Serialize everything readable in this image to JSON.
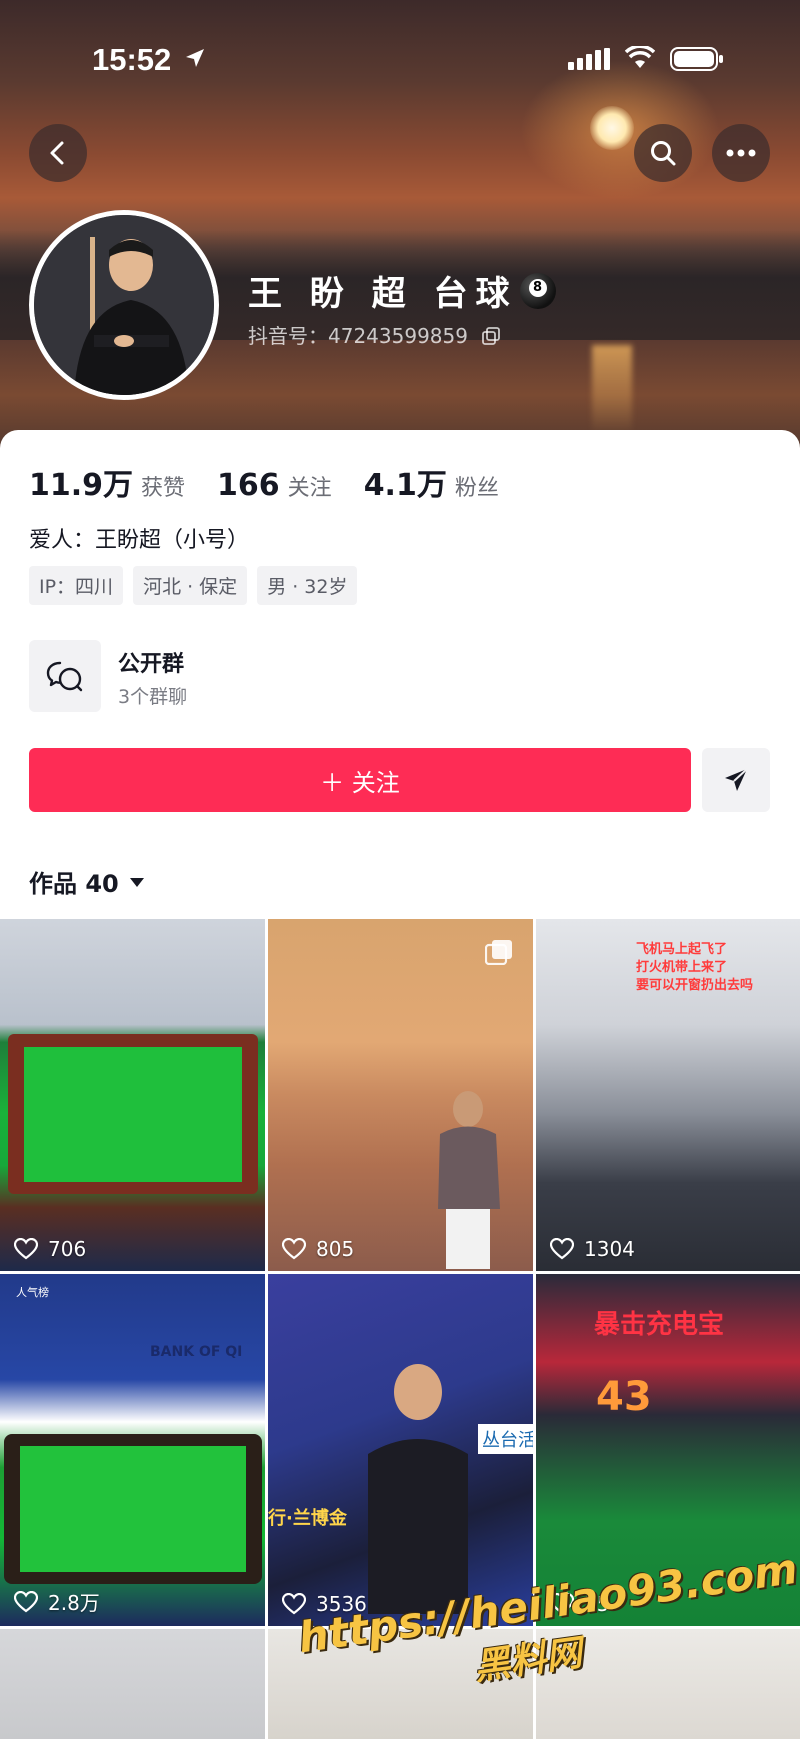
{
  "status_bar": {
    "time": "15:52"
  },
  "profile": {
    "name": "王 盼 超 台球",
    "douyin_id": "抖音号：47243599859"
  },
  "stats": [
    {
      "value": "11.9万",
      "label": "获赞"
    },
    {
      "value": "166",
      "label": "关注"
    },
    {
      "value": "4.1万",
      "label": "粉丝"
    }
  ],
  "bio": "爱人：王盼超（小号）",
  "tags": [
    "IP：四川",
    "河北 · 保定",
    "男 · 32岁"
  ],
  "group": {
    "title": "公开群",
    "subtitle": "3个群聊"
  },
  "actions": {
    "follow_label": "＋ 关注"
  },
  "works": {
    "tab_label": "作品 40"
  },
  "videos": [
    {
      "likes": "706"
    },
    {
      "likes": "805"
    },
    {
      "likes": "1304"
    },
    {
      "likes": "2.8万"
    },
    {
      "likes": "3536"
    },
    {
      "likes": "25"
    }
  ],
  "overlays": {
    "plane_caption_1": "飞机马上起飞了",
    "plane_caption_2": "打火机带上来了",
    "plane_caption_3": "要可以开窗扔出去吗",
    "tile6_banner": "暴击充电宝",
    "tile6_score": "43",
    "tile4_badge": "人气榜",
    "tile4_bank": "BANK OF QI",
    "tile5_brand": "丛台活",
    "tile5_sign": "行·兰博金"
  },
  "watermark": {
    "url": "https://heiliao93.com",
    "cn": "黑料网"
  },
  "colors": {
    "follow": "#fe2c55",
    "text": "#161823",
    "muted": "#6b6d75"
  }
}
